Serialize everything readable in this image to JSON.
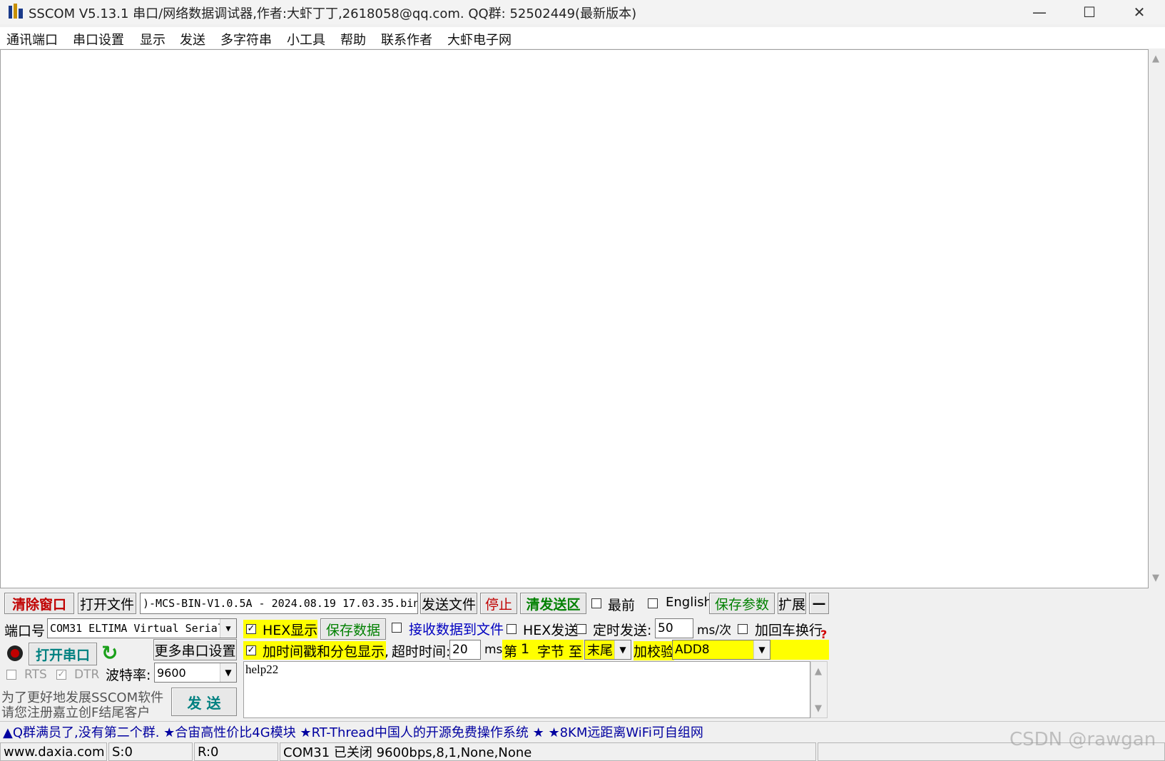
{
  "window": {
    "title": "SSCOM V5.13.1 串口/网络数据调试器,作者:大虾丁丁,2618058@qq.com. QQ群: 52502449(最新版本)",
    "minimize_icon": "minimize-icon",
    "maximize_icon": "maximize-icon",
    "close_icon": "close-icon"
  },
  "menu": [
    "通讯端口",
    "串口设置",
    "显示",
    "发送",
    "多字符串",
    "小工具",
    "帮助",
    "联系作者",
    "大虾电子网"
  ],
  "toolbar": {
    "clear_window": "清除窗口",
    "open_file": "打开文件",
    "file_path": ")-MCS-BIN-V1.0.5A - 2024.08.19 17.03.35.bin",
    "send_file": "发送文件",
    "stop": "停止",
    "clear_send": "清发送区",
    "topmost": "最前",
    "english": "English",
    "save_params": "保存参数",
    "expand": "扩展",
    "collapse": "—"
  },
  "port": {
    "port_label": "端口号",
    "port_value": "COM31 ELTIMA Virtual Serial",
    "open_port": "打开串口",
    "more_settings": "更多串口设置",
    "rts": "RTS",
    "dtr": "DTR",
    "baud_label": "波特率:",
    "baud_value": "9600",
    "promo_line1": "为了更好地发展SSCOM软件",
    "promo_line2": "请您注册嘉立创F结尾客户",
    "send": "发  送"
  },
  "options": {
    "hex_display": "HEX显示",
    "save_data": "保存数据",
    "recv_to_file": "接收数据到文件",
    "hex_send": "HEX发送",
    "timed_send": "定时发送:",
    "interval": "50",
    "interval_unit": "ms/次",
    "add_crlf": "加回车换行",
    "timestamp": "加时间戳和分包显示,",
    "timeout_label": "超时时间:",
    "timeout": "20",
    "timeout_unit": "ms",
    "byte_from_label": "第",
    "byte_from": "1",
    "byte_to_label": "字节 至",
    "byte_to": "末尾",
    "checksum_label": "加校验",
    "checksum": "ADD8",
    "help": "?"
  },
  "send_text": "help22",
  "ticker": "▲Q群满员了,没有第二个群. ★合宙高性价比4G模块 ★RT-Thread中国人的开源免费操作系统 ★ ★8KM远距离WiFi可自组网",
  "status": {
    "site": "www.daxia.com",
    "sent": "S:0",
    "recv": "R:0",
    "port_state": "COM31 已关闭  9600bps,8,1,None,None"
  },
  "watermark": "CSDN @rawgan",
  "colors": {
    "accent_red": "#c00000",
    "accent_green": "#008000",
    "blue_text": "#0000c0",
    "highlight": "#ffff00"
  }
}
